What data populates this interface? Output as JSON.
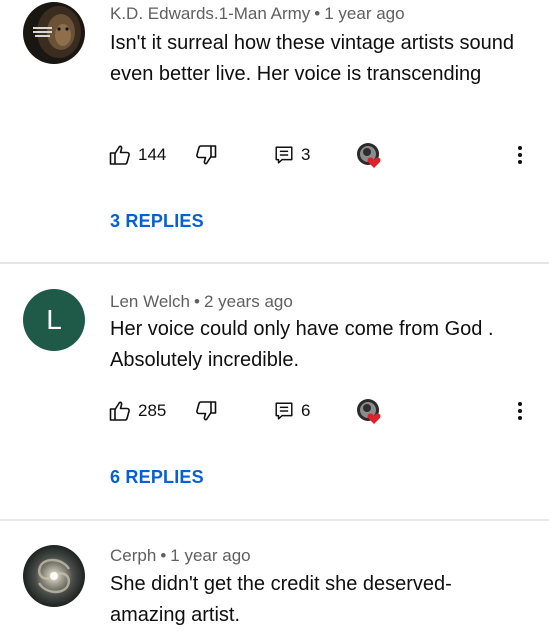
{
  "comments": [
    {
      "author": "K.D. Edwards.1-Man Army",
      "separator": "•",
      "time": "1 year ago",
      "text": "Isn't it surreal how these vintage artists sound even better live. Her voice is transcending",
      "likes": "144",
      "replies_count": "3",
      "view_replies": "3 REPLIES",
      "avatar_icon": "lion-avatar-icon",
      "avatar_text": "BE LIKE PASSIONATE BEFORE THE BATTLE"
    },
    {
      "author": "Len Welch",
      "separator": "•",
      "time": "2 years ago",
      "text": "Her voice could only have come from God . Absolutely incredible.",
      "likes": "285",
      "replies_count": "6",
      "view_replies": "6 REPLIES",
      "avatar_letter": "L",
      "avatar_color": "#1f5a48"
    },
    {
      "author": "Cerph",
      "separator": "•",
      "time": "1 year ago",
      "text": "She didn't get the credit she deserved- amazing artist.",
      "avatar_icon": "galaxy-avatar-icon"
    }
  ],
  "colors": {
    "link": "#065fd4",
    "meta": "#606060",
    "heart": "#e0202a",
    "divider": "#e6e6e6"
  },
  "icons": [
    "thumbs-up-icon",
    "thumbs-down-icon",
    "reply-icon",
    "creator-heart-icon",
    "more-vert-icon"
  ]
}
